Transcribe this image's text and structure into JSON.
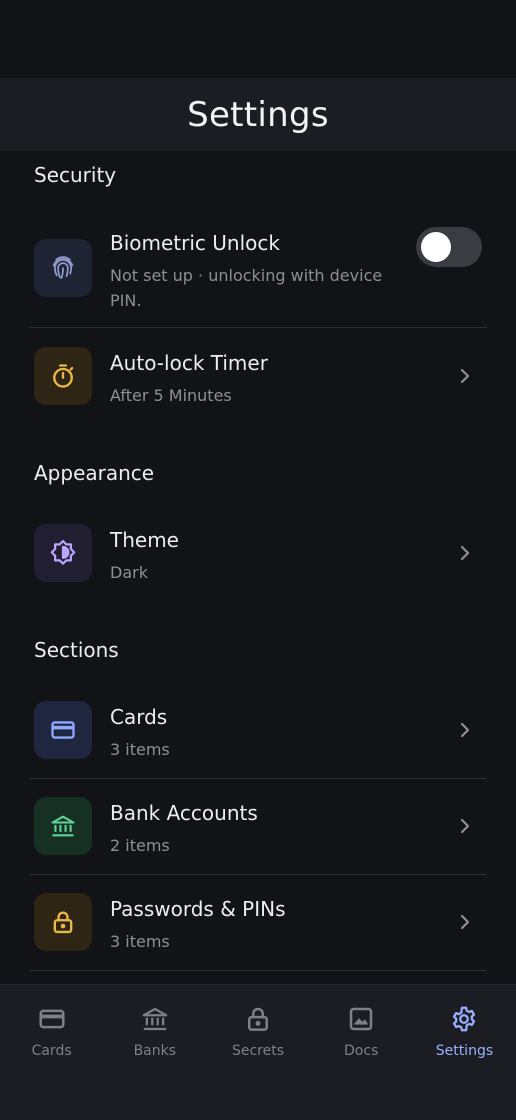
{
  "header": {
    "title": "Settings"
  },
  "sections": {
    "security": "Security",
    "appearance": "Appearance",
    "sections": "Sections"
  },
  "rows": {
    "biometric": {
      "title": "Biometric Unlock",
      "subtitle": "Not set up · unlocking with device PIN.",
      "toggle_on": false
    },
    "autolock": {
      "title": "Auto-lock Timer",
      "subtitle": "After 5 Minutes"
    },
    "theme": {
      "title": "Theme",
      "subtitle": "Dark"
    },
    "cards": {
      "title": "Cards",
      "subtitle": "3 items"
    },
    "banks": {
      "title": "Bank Accounts",
      "subtitle": "2 items"
    },
    "passwords": {
      "title": "Passwords & PINs",
      "subtitle": "3 items"
    }
  },
  "icons": {
    "biometric": "fingerprint-icon",
    "autolock": "stopwatch-icon",
    "theme": "brightness-icon",
    "cards": "credit-card-icon",
    "banks": "bank-icon",
    "passwords": "lock-icon"
  },
  "colors": {
    "accent": "#9AB0FF",
    "amber": "#E9B84A",
    "purple": "#B9A6FF",
    "green": "#5FD49A",
    "blue": "#8EA7FF"
  },
  "tabs": [
    {
      "label": "Cards",
      "icon": "credit-card-icon",
      "active": false
    },
    {
      "label": "Banks",
      "icon": "bank-icon",
      "active": false
    },
    {
      "label": "Secrets",
      "icon": "lock-icon",
      "active": false
    },
    {
      "label": "Docs",
      "icon": "image-icon",
      "active": false
    },
    {
      "label": "Settings",
      "icon": "gear-icon",
      "active": true
    }
  ]
}
